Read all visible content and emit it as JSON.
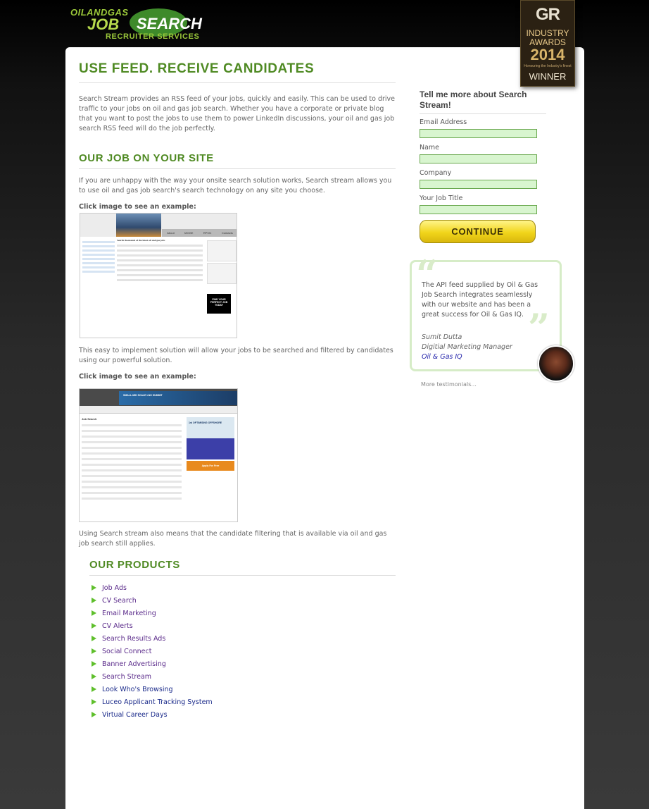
{
  "logo": {
    "line1": "OILANDGAS",
    "line2": "JOB",
    "line3": "SEARCH",
    "line4": "RECRUITER SERVICES"
  },
  "award": {
    "gr": "GR",
    "line1": "INDUSTRY",
    "line2": "AWARDS",
    "year": "2014",
    "sub": "Honouring the Industry's finest",
    "winner": "WINNER"
  },
  "main": {
    "title": "USE FEED. RECEIVE CANDIDATES",
    "intro": "Search Stream provides an RSS feed of your jobs, quickly and easily. This can be used to drive traffic to your jobs on oil and gas job search. Whether you have a corporate or private blog that you want to post the jobs to use them to power LinkedIn discussions, your oil and gas job search RSS feed will do the job perfectly.",
    "section2_title": "OUR JOB ON YOUR SITE",
    "section2_text": "If you are unhappy with the way your onsite search solution works, Search stream allows you to use oil and gas job search's search technology on any site you choose.",
    "click1": "Click image to see an example:",
    "after1": "This easy to implement solution will allow your jobs to be searched and filtered by candidates using our powerful solution.",
    "click2": "Click image to see an example:",
    "after2": "Using Search stream also means that the candidate filtering that is available via oil and gas job search still applies."
  },
  "shot1": {
    "nav": [
      "About",
      "MOGE",
      "RPOC",
      "Contacts"
    ],
    "heading": "Search thousands of the latest oil and gas jobs",
    "ad": "FIND YOUR PERFECT JOB TODAY"
  },
  "shot2": {
    "heading": "Job Search",
    "banner": "SMALL-MID SCALE LNG SUMMIT",
    "ad1": "1st OPTIMISING OFFSHORE",
    "ad3": "Apply For Free"
  },
  "products": {
    "title": "OUR PRODUCTS",
    "items": [
      "Job Ads",
      "CV Search",
      "Email Marketing",
      "CV Alerts",
      "Search Results Ads",
      "Social Connect",
      "Banner Advertising",
      "Search Stream",
      "Look Who's Browsing",
      "Luceo Applicant Tracking System",
      "Virtual Career Days"
    ]
  },
  "form": {
    "title": "Tell me more about Search Stream!",
    "fields": [
      "Email Address",
      "Name",
      "Company",
      "Your Job Title"
    ],
    "button": "CONTINUE"
  },
  "testimonial": {
    "text": "The API feed supplied by Oil & Gas Job Search integrates seamlessly with our website and has been a great success for Oil & Gas IQ.",
    "name": "Sumit Dutta",
    "role": "Digitial Marketing Manager",
    "company": "Oil & Gas IQ",
    "more": "More testimonials..."
  },
  "colors": {
    "accent_green": "#4f8a23",
    "link_purple": "#5a2a8a",
    "button_yellow": "#f1d51b",
    "input_green": "#d8f5cf"
  }
}
